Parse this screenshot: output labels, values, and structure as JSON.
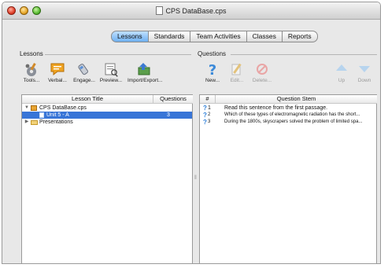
{
  "window": {
    "title": "CPS DataBase.cps"
  },
  "tabs": [
    {
      "label": "Lessons",
      "active": true
    },
    {
      "label": "Standards",
      "active": false
    },
    {
      "label": "Team Activities",
      "active": false
    },
    {
      "label": "Classes",
      "active": false
    },
    {
      "label": "Reports",
      "active": false
    }
  ],
  "lessons": {
    "section_label": "Lessons",
    "toolbar": [
      {
        "label": "Tools...",
        "icon": "tools-icon"
      },
      {
        "label": "Verbal...",
        "icon": "verbal-icon"
      },
      {
        "label": "Engage...",
        "icon": "engage-icon"
      },
      {
        "label": "Preview...",
        "icon": "preview-icon"
      },
      {
        "label": "Import/Export...",
        "icon": "import-export-icon"
      }
    ],
    "columns": {
      "title": "Lesson Title",
      "questions": "Questions"
    },
    "rows": [
      {
        "title": "CPS DataBase.cps",
        "count": "",
        "level": 0,
        "expanded": true,
        "kind": "database"
      },
      {
        "title": "Unit 5 - A",
        "count": "3",
        "level": 1,
        "selected": true,
        "kind": "lesson"
      },
      {
        "title": "Presentations",
        "count": "",
        "level": 0,
        "expanded": false,
        "kind": "folder"
      }
    ]
  },
  "questions": {
    "section_label": "Questions",
    "toolbar": [
      {
        "label": "New...",
        "icon": "new-question-icon",
        "enabled": true
      },
      {
        "label": "Edit...",
        "icon": "edit-icon",
        "enabled": false
      },
      {
        "label": "Delete...",
        "icon": "delete-icon",
        "enabled": false
      },
      {
        "label": "Up",
        "icon": "up-arrow-icon",
        "enabled": false
      },
      {
        "label": "Down",
        "icon": "down-arrow-icon",
        "enabled": false
      }
    ],
    "columns": {
      "number": "#",
      "stem": "Question Stem"
    },
    "rows": [
      {
        "number": "1",
        "stem": "Read this sentence from the first passage."
      },
      {
        "number": "2",
        "stem": "Which of these types of electromagnetic radiation has the short..."
      },
      {
        "number": "3",
        "stem": "During the 1800s, skyscrapers solved the problem of limited spa..."
      }
    ]
  },
  "colors": {
    "selection": "#3875d7",
    "active_tab": "#6fb0f0",
    "question_mark": "#2d7fd8"
  }
}
